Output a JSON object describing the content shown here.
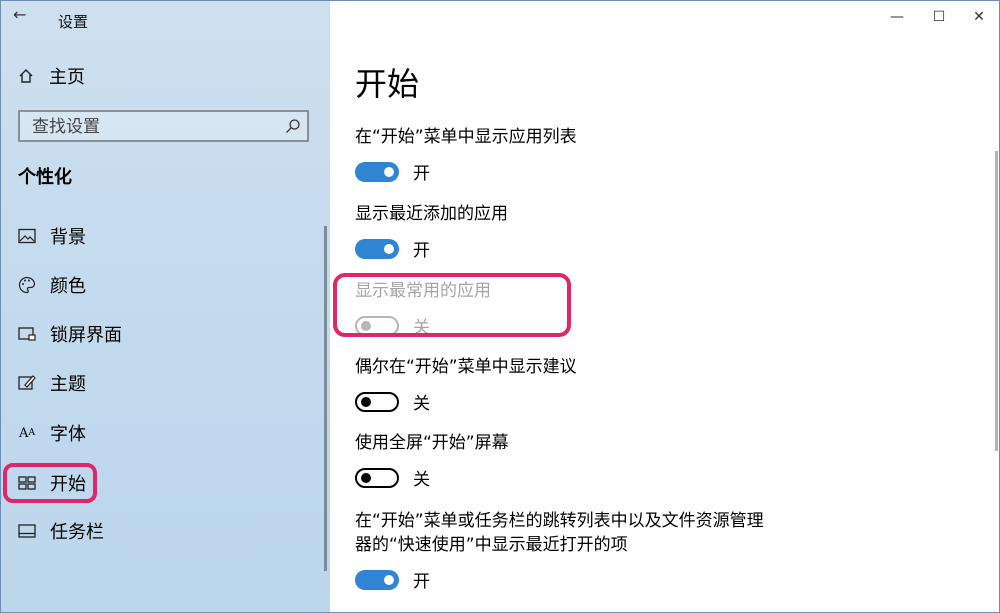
{
  "app_title": "设置",
  "sidebar": {
    "home_label": "主页",
    "search_placeholder": "查找设置",
    "section_title": "个性化",
    "items": [
      {
        "label": "背景",
        "icon": "picture-icon"
      },
      {
        "label": "颜色",
        "icon": "palette-icon"
      },
      {
        "label": "锁屏界面",
        "icon": "lock-screen-icon"
      },
      {
        "label": "主题",
        "icon": "theme-icon"
      },
      {
        "label": "字体",
        "icon": "font-icon"
      },
      {
        "label": "开始",
        "icon": "start-icon",
        "selected": true
      },
      {
        "label": "任务栏",
        "icon": "taskbar-icon"
      }
    ]
  },
  "window_controls": {
    "minimize": "—",
    "maximize": "☐",
    "close": "✕"
  },
  "main": {
    "title": "开始",
    "settings": [
      {
        "label": "在“开始”菜单中显示应用列表",
        "state": "开",
        "on": true
      },
      {
        "label": "显示最近添加的应用",
        "state": "开",
        "on": true
      },
      {
        "label": "显示最常用的应用",
        "state": "关",
        "on": false,
        "disabled": true
      },
      {
        "label": "偶尔在“开始”菜单中显示建议",
        "state": "关",
        "on": false
      },
      {
        "label": "使用全屏“开始”屏幕",
        "state": "关",
        "on": false
      },
      {
        "label_line1": "在“开始”菜单或任务栏的跳转列表中以及文件资源管理",
        "label_line2": "器的“快速使用”中显示最近打开的项",
        "state": "开",
        "on": true
      }
    ]
  },
  "colors": {
    "accent": "#2f85d2",
    "highlight": "#e0256a"
  }
}
